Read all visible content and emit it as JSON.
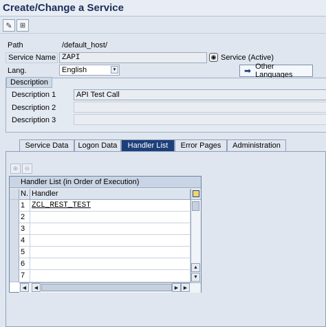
{
  "window": {
    "title": "Create/Change a Service"
  },
  "toolbar": {
    "edit_icon": "pencil-glasses-icon",
    "hierarchy_icon": "hierarchy-icon"
  },
  "form": {
    "path_label": "Path",
    "path_value": "/default_host/",
    "service_name_label": "Service Name",
    "service_name_value": "ZAPI",
    "service_status": "Service (Active)",
    "lang_label": "Lang.",
    "lang_value": "English",
    "other_languages_label": "Other Languages"
  },
  "description": {
    "title": "Description",
    "rows": [
      {
        "label": "Description 1",
        "value": "API Test Call"
      },
      {
        "label": "Description 2",
        "value": ""
      },
      {
        "label": "Description 3",
        "value": ""
      }
    ]
  },
  "tabs": [
    {
      "label": "Service Data",
      "active": false
    },
    {
      "label": "Logon Data",
      "active": false
    },
    {
      "label": "Handler List",
      "active": true
    },
    {
      "label": "Error Pages",
      "active": false
    },
    {
      "label": "Administration",
      "active": false
    }
  ],
  "handler_grid": {
    "title": "Handler List (in Order of Execution)",
    "col_n": "N.",
    "col_handler": "Handler",
    "rows": [
      {
        "n": "1",
        "handler": "ZCL_REST_TEST"
      },
      {
        "n": "2",
        "handler": ""
      },
      {
        "n": "3",
        "handler": ""
      },
      {
        "n": "4",
        "handler": ""
      },
      {
        "n": "5",
        "handler": ""
      },
      {
        "n": "6",
        "handler": ""
      },
      {
        "n": "7",
        "handler": ""
      }
    ]
  },
  "colors": {
    "active_tab": "#1d3f7a",
    "title_text": "#1a2d5a",
    "background": "#dfe6ef"
  }
}
